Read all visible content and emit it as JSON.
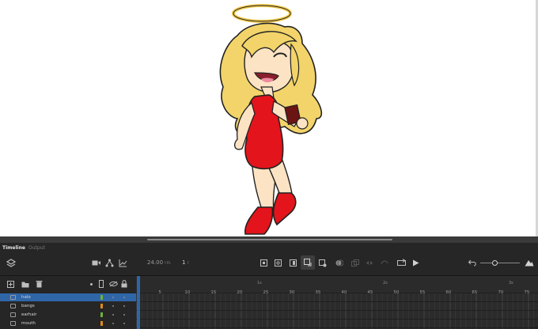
{
  "panel_tabs": [
    "Timeline",
    "Output"
  ],
  "toolbar": {
    "fps_value": "24.00",
    "fps_unit": "FPS",
    "frame_value": "1",
    "frame_unit": "F"
  },
  "ruler": {
    "seconds": [
      "1s",
      "2s",
      "3s"
    ],
    "frames": [
      "5",
      "10",
      "15",
      "20",
      "25",
      "30",
      "35",
      "40",
      "45",
      "50",
      "55",
      "60",
      "65",
      "70",
      "75"
    ]
  },
  "layers": [
    {
      "name": "halo",
      "color": "#6fb23a",
      "selected": true
    },
    {
      "name": "bangs",
      "color": "#e08a1a",
      "selected": false
    },
    {
      "name": "earhair",
      "color": "#6fb23a",
      "selected": false
    },
    {
      "name": "mouth",
      "color": "#e08a1a",
      "selected": false
    }
  ],
  "colors": {
    "accent": "#2f66a8",
    "dress": "#e3141b",
    "hair": "#f2d46a",
    "skin": "#fbe3c4"
  },
  "icons": [
    "layers-icon",
    "camera-icon",
    "rig-icon",
    "graph-icon",
    "insert-keyframe-icon",
    "blank-keyframe-icon",
    "clear-keyframe-icon",
    "motion-tween-icon",
    "paste-motion-icon",
    "onion-skin-icon",
    "edit-multiple-icon",
    "loop-icon",
    "play-icon",
    "undo-icon",
    "zoom-slider",
    "mountain-icon",
    "new-layer-icon",
    "new-folder-icon",
    "trash-icon",
    "outline-icon",
    "visibility-icon",
    "lock-icon"
  ]
}
